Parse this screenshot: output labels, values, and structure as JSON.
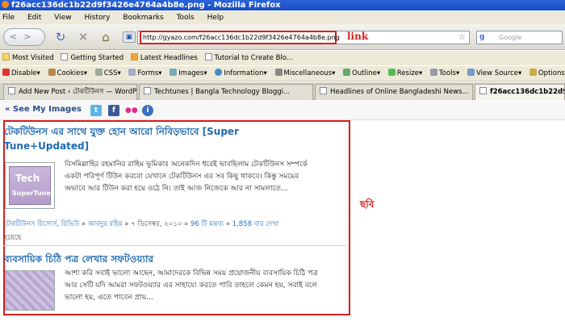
{
  "window": {
    "title": "f26acc136dc1b22d9f3426e4764a4b8e.png - Mozilla Firefox"
  },
  "menu": [
    "File",
    "Edit",
    "View",
    "History",
    "Bookmarks",
    "Tools",
    "Help"
  ],
  "nav": {
    "url": "http://gyazo.com/f26acc136dc1b22d9f3426e4764a4b8e.png",
    "url_note": "link",
    "search_placeholder": "Google",
    "search_engine_letter": "g"
  },
  "bookmarks": [
    "Most Visited",
    "Getting Started",
    "Latest Headlines",
    "Tutorial to Create Blo..."
  ],
  "devtools": [
    "Disable▾",
    "Cookies▾",
    "CSS▾",
    "Forms▾",
    "Images▾",
    "Information▾",
    "Miscellaneous▾",
    "Outline▾",
    "Resize▾",
    "Tools▾",
    "View Source▾",
    "Options▾"
  ],
  "tabs": [
    {
      "label": "Add New Post ‹ টেকটিউনস — WordPress"
    },
    {
      "label": "Techtunes | Bangla Technology Bloggi..."
    },
    {
      "label": "Headlines of Online Bangladeshi News..."
    },
    {
      "label": "f26acc136dc1b22d9f3..."
    }
  ],
  "pagebar": {
    "see_images": "« See My Images"
  },
  "page": {
    "image_note": "ছবি",
    "posts": [
      {
        "title_line1": "টেকটিউনস এর সাথে যুক্ত হোন আরো নিবিড়ভাবে [Super",
        "title_line2": "Tune+Updated]",
        "body_line1": "বিসমিল্লাহির রহমানির রাহিম ভূমিকাঃ অনেকদিন ধরেই ভাবছিলাম টেকটিউনস সম্পর্কে",
        "body_line2": "একটা পরিপূর্ণ টিউন করবো যেখানে টেকটিউনস এর সব কিছু থাকবে। কিন্তু সময়ের",
        "body_line3": "অভাবে আর টিউন করা হয়ে ওঠে নি। তাই আজ নিজেকে আর না সামলাতে...",
        "thumb_text1": "Tech",
        "thumb_text2": "SuperTune",
        "meta_categories": "টেকটিউনস রিসোর্স, রিভিউ",
        "meta_author": "আবদুর রহিম",
        "meta_date": "৭ ডিসেম্বর, ২০১০",
        "meta_comments": "96 টি মন্তব্য",
        "meta_views": "1,858 বার দেখা",
        "meta_views2": "হয়েছে"
      },
      {
        "title_line1": "ব্যবসায়িক চিঠি পত্র লেখার সফটওয়্যার",
        "body_line1": "আশা করি সবাই ভালো আছেন, আমাদেরকে বিভিন্ন সময় প্রয়োজনীয় ব্যবসায়িক চিঠি পত্র",
        "body_line2": "আর সেটি যদি আমরা সফটওয়্যার এর সাহায্যে করতে পারি তাহলে কেমন হয়, সবাই বলে",
        "body_line3": "ভালো হয়, এতে পাবেন প্রায়..."
      }
    ]
  }
}
